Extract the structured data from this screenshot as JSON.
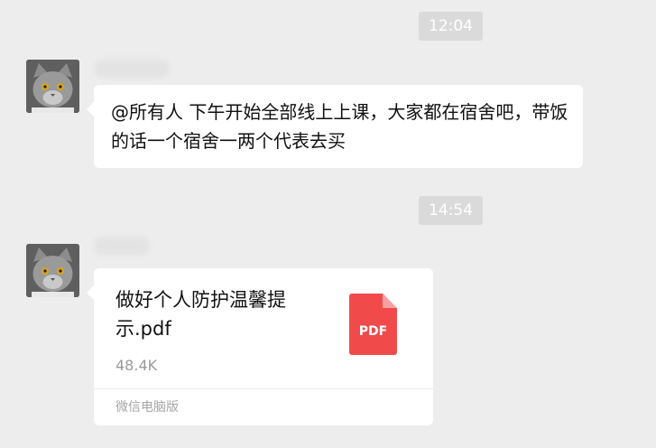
{
  "messages": [
    {
      "time": "12:04",
      "type": "text",
      "text": "@所有人 下午开始全部线上上课，大家都在宿舍吧，带饭的话一个宿舍一两个代表去买"
    },
    {
      "time": "14:54",
      "type": "file",
      "file_name": "做好个人防护温馨提示.pdf",
      "file_size": "48.4K",
      "file_icon_label": "PDF",
      "source": "微信电脑版"
    }
  ],
  "avatar_icon": "cat-avatar-icon",
  "colors": {
    "background": "#ededed",
    "bubble": "#ffffff",
    "pdf_red": "#f04a4a",
    "time_badge": "#dadada"
  }
}
